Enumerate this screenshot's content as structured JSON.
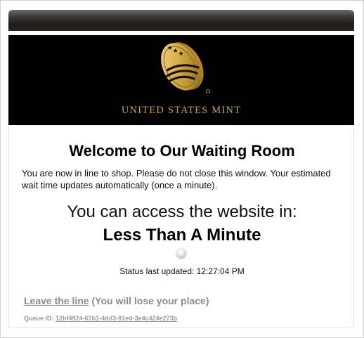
{
  "header": {
    "brand": "UNITED STATES MINT",
    "logo_icon": "us-mint-coin-logo"
  },
  "main": {
    "title": "Welcome to Our Waiting Room",
    "intro": "You are now in line to shop. Please do not close this window. Your estimated wait time updates automatically (once a minute).",
    "access_text": "You can access the website in:",
    "wait_time": "Less Than A Minute",
    "spinner_icon": "loading-spinner-icon",
    "status_updated": "Status last updated: 12:27:04 PM"
  },
  "footer": {
    "leave_link": "Leave the line",
    "leave_note": "(You will lose your place)",
    "queue_label": "Queue ID:",
    "queue_id": "12bf4924-67b1-4dd3-81ed-3e4c424e273b"
  },
  "colors": {
    "header_bg": "#000000",
    "brand_gold": "#c9a54a",
    "link_gray": "#8a8a8a"
  }
}
